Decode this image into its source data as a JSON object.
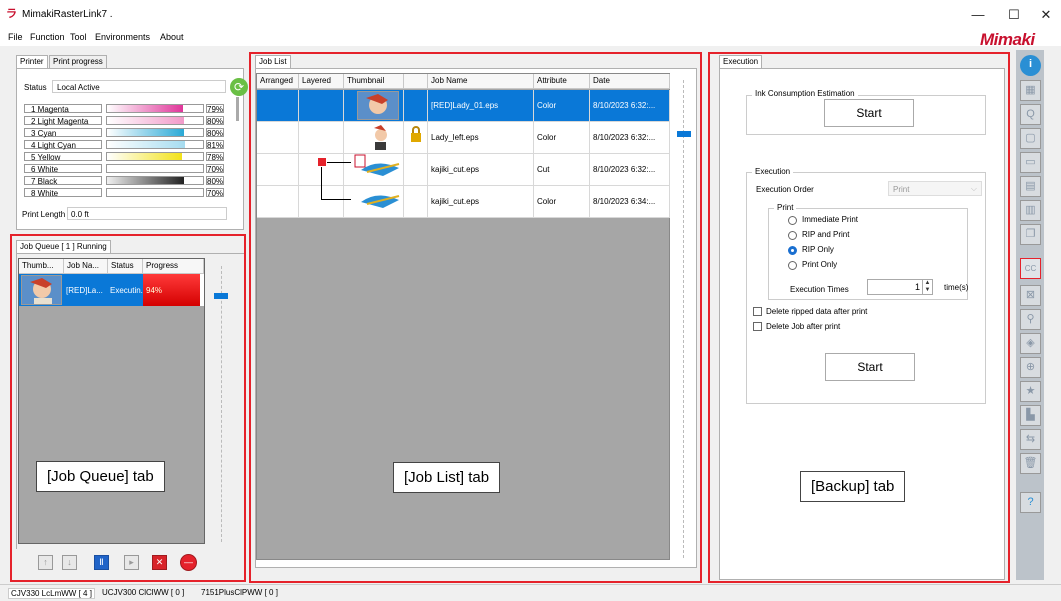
{
  "app": {
    "title": "MimakiRasterLink7 .",
    "logo": "Mimaki",
    "icon": "ラ"
  },
  "window_controls": {
    "minimize": "—",
    "maximize": "☐",
    "close": "✕"
  },
  "menu": [
    "File",
    "Function",
    "Tool",
    "Environments",
    "About"
  ],
  "printer_panel": {
    "tabs": [
      "Printer",
      "Print progress"
    ],
    "status_label": "Status",
    "status_value": "Local Active",
    "inks": [
      {
        "label": "1 Magenta",
        "pct": "79%",
        "level": 0.79,
        "color": "#e0369a"
      },
      {
        "label": "2 Light Magenta",
        "pct": "80%",
        "level": 0.8,
        "color": "#f29ac9"
      },
      {
        "label": "3 Cyan",
        "pct": "80%",
        "level": 0.8,
        "color": "#2aa9d6"
      },
      {
        "label": "4 Light Cyan",
        "pct": "81%",
        "level": 0.81,
        "color": "#a6dcf0"
      },
      {
        "label": "5 Yellow",
        "pct": "78%",
        "level": 0.78,
        "color": "#f2e21a"
      },
      {
        "label": "6 White",
        "pct": "70%",
        "level": 0.7,
        "color": "#ffffff"
      },
      {
        "label": "7 Black",
        "pct": "80%",
        "level": 0.8,
        "color": "#222222"
      },
      {
        "label": "8 White",
        "pct": "70%",
        "level": 0.7,
        "color": "#ffffff"
      }
    ],
    "print_length_label": "Print Length",
    "print_length_value": "0.0 ft"
  },
  "job_queue": {
    "tab": "Job Queue [ 1 ] Running",
    "columns": [
      "Thumb...",
      "Job Na...",
      "Status",
      "Progress"
    ],
    "rows": [
      {
        "name": "[RED]La...",
        "status": "Executin...",
        "progress": "94%",
        "level": 0.94
      }
    ],
    "annotation": "[Job Queue] tab"
  },
  "job_list": {
    "tab": "Job List",
    "columns": [
      "Arranged",
      "Layered",
      "Thumbnail",
      "",
      "Job Name",
      "Attribute",
      "Date"
    ],
    "rows": [
      {
        "name": "[RED]Lady_01.eps",
        "attribute": "Color",
        "date": "8/10/2023 6:32:..."
      },
      {
        "name": "Lady_left.eps",
        "attribute": "Color",
        "date": "8/10/2023 6:32:..."
      },
      {
        "name": "kajiki_cut.eps",
        "attribute": "Cut",
        "date": "8/10/2023 6:32:..."
      },
      {
        "name": "kajiki_cut.eps",
        "attribute": "Color",
        "date": "8/10/2023 6:34:..."
      }
    ],
    "annotation": "[Job List] tab"
  },
  "execution": {
    "tab": "Execution",
    "ink_group": "Ink Consumption Estimation",
    "start": "Start",
    "exec_group": "Execution",
    "order_label": "Execution Order",
    "order_value": "Print",
    "print_group": "Print",
    "options": [
      "Immediate Print",
      "RIP and Print",
      "RIP Only",
      "Print Only"
    ],
    "selected_option": "RIP Only",
    "times_label": "Execution Times",
    "times_value": "1",
    "times_unit": "time(s)",
    "checks": [
      "Delete ripped data after print",
      "Delete Job after print"
    ],
    "start2": "Start",
    "annotation": "[Backup] tab"
  },
  "statusbar": [
    "CJV330 LcLmWW [ 4 ]",
    "UCJV300 ClClWW [ 0 ]",
    "7151PlusClPWW [ 0 ]"
  ]
}
